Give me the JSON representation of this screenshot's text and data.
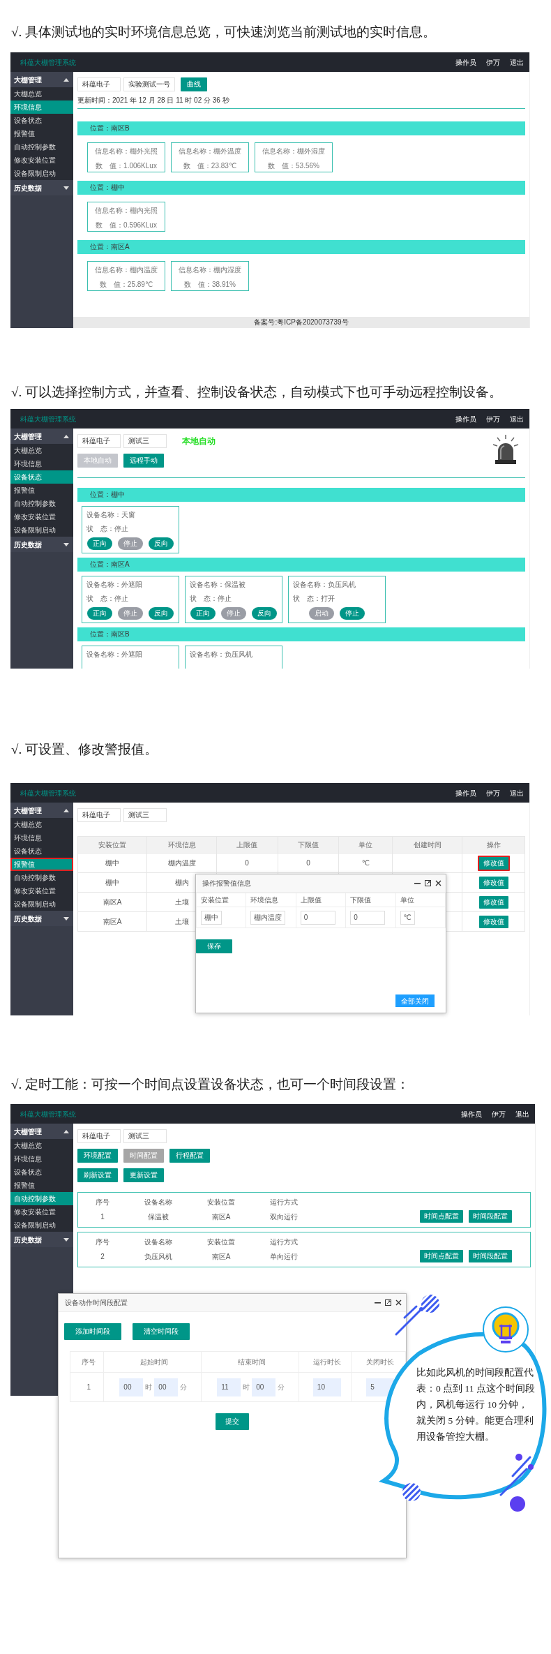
{
  "sections": [
    {
      "kind": "environment",
      "caption": "√. 具体测试地的实时环境信息总览，可快速浏览当前测试地的实时信息。",
      "app": {
        "title": "科蕴大棚管理系统",
        "user_menu": [
          "操作员",
          "伊万",
          "退出"
        ],
        "sidebar": [
          {
            "label": "大棚管理",
            "expanded": true,
            "children": [
              {
                "label": "大棚总览",
                "selected": false
              },
              {
                "label": "环境信息",
                "selected": true
              },
              {
                "label": "设备状态",
                "selected": false
              },
              {
                "label": "报警值",
                "selected": false
              },
              {
                "label": "自动控制参数",
                "selected": false
              },
              {
                "label": "修改安装位置",
                "selected": false
              },
              {
                "label": "设备限制启动",
                "selected": false
              }
            ]
          },
          {
            "label": "历史数据",
            "expanded": false
          }
        ]
      },
      "filters": [
        "科蕴电子",
        "实验测试一号"
      ],
      "action_button": "曲线",
      "update_time": "更新时间：2021 年 12 月 28 日 11 时 02 分 36 秒",
      "locations": [
        {
          "title": "位置：南区B",
          "cards": [
            {
              "name": "信息名称：棚外光照",
              "value": "数　值：1.006KLux"
            },
            {
              "name": "信息名称：棚外温度",
              "value": "数　值：23.83℃"
            },
            {
              "name": "信息名称：棚外湿度",
              "value": "数　值：53.56%"
            }
          ]
        },
        {
          "title": "位置：棚中",
          "cards": [
            {
              "name": "信息名称：棚内光照",
              "value": "数　值：0.596KLux"
            }
          ]
        },
        {
          "title": "位置：南区A",
          "cards": [
            {
              "name": "信息名称：棚内温度",
              "value": "数　值：25.89℃"
            },
            {
              "name": "信息名称：棚内湿度",
              "value": "数　值：38.91%"
            }
          ]
        }
      ],
      "footer": "备案号:粤ICP备2020073739号"
    },
    {
      "kind": "device_status",
      "caption": "√. 可以选择控制方式，并查看、控制设备状态，自动模式下也可手动远程控制设备。",
      "app": {
        "title": "科蕴大棚管理系统",
        "user_menu": [
          "操作员",
          "伊万",
          "退出"
        ],
        "sidebar": [
          {
            "label": "大棚管理",
            "expanded": true,
            "children": [
              {
                "label": "大棚总览",
                "selected": false
              },
              {
                "label": "环境信息",
                "selected": false
              },
              {
                "label": "设备状态",
                "selected": true
              },
              {
                "label": "报警值",
                "selected": false
              },
              {
                "label": "自动控制参数",
                "selected": false
              },
              {
                "label": "修改安装位置",
                "selected": false
              },
              {
                "label": "设备限制启动",
                "selected": false
              }
            ]
          },
          {
            "label": "历史数据",
            "expanded": false
          }
        ]
      },
      "filters": [
        "科蕴电子",
        "测试三"
      ],
      "mode_label": "本地自动",
      "modes": [
        {
          "label": "本地自动",
          "selected": true
        },
        {
          "label": "远程手动",
          "selected": false
        }
      ],
      "locations": [
        {
          "title": "位置：棚中",
          "devices": [
            {
              "name": "设备名称：天窗",
              "status": "状　态：停止",
              "buttons": [
                {
                  "label": "正向",
                  "enabled": true
                },
                {
                  "label": "停止",
                  "enabled": false
                },
                {
                  "label": "反向",
                  "enabled": true
                }
              ]
            }
          ]
        },
        {
          "title": "位置：南区A",
          "devices": [
            {
              "name": "设备名称：外遮阳",
              "status": "状　态：停止",
              "buttons": [
                {
                  "label": "正向",
                  "enabled": true
                },
                {
                  "label": "停止",
                  "enabled": false
                },
                {
                  "label": "反向",
                  "enabled": true
                }
              ]
            },
            {
              "name": "设备名称：保温被",
              "status": "状　态：停止",
              "buttons": [
                {
                  "label": "正向",
                  "enabled": true
                },
                {
                  "label": "停止",
                  "enabled": false
                },
                {
                  "label": "反向",
                  "enabled": true
                }
              ]
            },
            {
              "name": "设备名称：负压风机",
              "status": "状　态：打开",
              "buttons": [
                {
                  "label": "启动",
                  "enabled": false
                },
                {
                  "label": "停止",
                  "enabled": true
                }
              ]
            }
          ]
        },
        {
          "title": "位置：南区B",
          "devices": [
            {
              "name": "设备名称：外遮阳"
            },
            {
              "name": "设备名称：负压风机"
            }
          ]
        }
      ]
    },
    {
      "kind": "alarm",
      "caption": "√. 可设置、修改警报值。",
      "app": {
        "title": "科蕴大棚管理系统",
        "user_menu": [
          "操作员",
          "伊万",
          "退出"
        ],
        "sidebar": [
          {
            "label": "大棚管理",
            "expanded": true,
            "children": [
              {
                "label": "大棚总览",
                "selected": false,
                "annotated": false
              },
              {
                "label": "环境信息",
                "selected": false,
                "annotated": false
              },
              {
                "label": "设备状态",
                "selected": false,
                "annotated": false
              },
              {
                "label": "报警值",
                "selected": true,
                "annotated": true
              },
              {
                "label": "自动控制参数",
                "selected": false,
                "annotated": false
              },
              {
                "label": "修改安装位置",
                "selected": false,
                "annotated": false
              },
              {
                "label": "设备限制启动",
                "selected": false,
                "annotated": false
              }
            ]
          },
          {
            "label": "历史数据",
            "expanded": false
          }
        ]
      },
      "filters": [
        "科蕴电子",
        "测试三"
      ],
      "table": {
        "columns": [
          "安装位置",
          "环境信息",
          "上限值",
          "下限值",
          "单位",
          "创建时间",
          "操作"
        ],
        "rows": [
          {
            "cells": [
              "棚中",
              "棚内温度",
              "0",
              "0",
              "℃"
            ],
            "action": "修改值",
            "annotated": true
          },
          {
            "cells": [
              "棚中",
              "棚内"
            ],
            "action": "修改值",
            "annotated": false
          },
          {
            "cells": [
              "南区A",
              "土壤"
            ],
            "action": "修改值",
            "annotated": false
          },
          {
            "cells": [
              "南区A",
              "土壤"
            ],
            "action": "修改值",
            "annotated": false
          }
        ]
      },
      "dialog": {
        "title": "操作报警值信息",
        "columns": [
          "安装位置",
          "环境信息",
          "上限值",
          "下限值",
          "单位"
        ],
        "row": [
          {
            "value": "棚中",
            "kind": "readonly"
          },
          {
            "value": "棚内温度",
            "kind": "readonly"
          },
          {
            "value": "0",
            "kind": "input"
          },
          {
            "value": "0",
            "kind": "input"
          },
          {
            "value": "℃",
            "kind": "readonly"
          }
        ],
        "save_button": "保存",
        "close_all_button": "全部关闭"
      }
    },
    {
      "kind": "timer",
      "caption": "√. 定时工能：可按一个时间点设置设备状态，也可一个时间段设置：",
      "app": {
        "title": "科蕴大棚管理系统",
        "user_menu": [
          "操作员",
          "伊万",
          "退出"
        ],
        "sidebar": [
          {
            "label": "大棚管理",
            "expanded": true,
            "children": [
              {
                "label": "大棚总览",
                "selected": false
              },
              {
                "label": "环境信息",
                "selected": false
              },
              {
                "label": "设备状态",
                "selected": false
              },
              {
                "label": "报警值",
                "selected": false
              },
              {
                "label": "自动控制参数",
                "selected": true
              },
              {
                "label": "修改安装位置",
                "selected": false
              },
              {
                "label": "设备限制启动",
                "selected": false
              }
            ]
          },
          {
            "label": "历史数据",
            "expanded": false
          }
        ]
      },
      "filters": [
        "科蕴电子",
        "测试三"
      ],
      "config_tabs": [
        {
          "label": "环境配置",
          "selected": false
        },
        {
          "label": "时间配置",
          "selected": true
        },
        {
          "label": "行程配置",
          "selected": false
        }
      ],
      "actions": [
        "刷新设置",
        "更新设置"
      ],
      "devices": [
        {
          "labels": [
            "序号",
            "设备名称",
            "安装位置",
            "运行方式"
          ],
          "cells": [
            "1",
            "保温被",
            "南区A",
            "双向运行"
          ],
          "buttons": [
            "时间点配置",
            "时间段配置"
          ]
        },
        {
          "labels": [
            "序号",
            "设备名称",
            "安装位置",
            "运行方式"
          ],
          "cells": [
            "2",
            "负压风机",
            "南区A",
            "单向运行"
          ],
          "buttons": [
            "时间点配置",
            "时间段配置"
          ]
        }
      ],
      "dialog": {
        "title": "设备动作时间段配置",
        "buttons": [
          "添加时间段",
          "清空时间段"
        ],
        "columns": [
          "序号",
          "起始时间",
          "结束时间",
          "运行时长",
          "关闭时长"
        ],
        "rows": [
          {
            "index": "1",
            "start": {
              "hour": "00",
              "hour_unit": "时",
              "minute": "00",
              "minute_unit": "分"
            },
            "end": {
              "hour": "11",
              "hour_unit": "时",
              "minute": "00",
              "minute_unit": "分"
            },
            "run": "10",
            "off": "5"
          }
        ],
        "submit": "提交"
      },
      "callout": "比如此风机的时间段配置代表：0 点到 11 点这个时间段内，风机每运行 10 分钟，就关闭 5 分钟。能更合理利用设备管控大棚。"
    }
  ]
}
